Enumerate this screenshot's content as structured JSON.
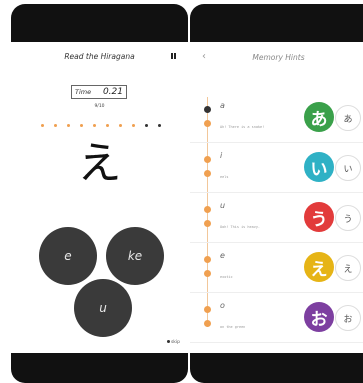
{
  "quiz": {
    "title": "Read the Hiragana",
    "timer_label": "Time",
    "timer_value": "0.21",
    "progress": "9/10",
    "current_kana": "え",
    "answers": [
      "e",
      "ke",
      "u"
    ],
    "skip_label": "skip",
    "dots": {
      "total": 10,
      "completed": 8
    }
  },
  "hints": {
    "title": "Memory Hints",
    "back_glyph": "‹",
    "items": [
      {
        "romaji": "a",
        "mnemonic": "Ah! There is a snake!",
        "kana": "あ",
        "color": "#3aa04a"
      },
      {
        "romaji": "i",
        "mnemonic": "eels",
        "kana": "い",
        "color": "#2fb1c5"
      },
      {
        "romaji": "u",
        "mnemonic": "Ooh! This is heavy.",
        "kana": "う",
        "color": "#e23b3b"
      },
      {
        "romaji": "e",
        "mnemonic": "exotic",
        "kana": "え",
        "color": "#e6b416"
      },
      {
        "romaji": "o",
        "mnemonic": "on the green",
        "kana": "お",
        "color": "#7d3fa0"
      }
    ]
  },
  "colors": {
    "accent": "#f0a050",
    "button": "#3a3a3a"
  }
}
